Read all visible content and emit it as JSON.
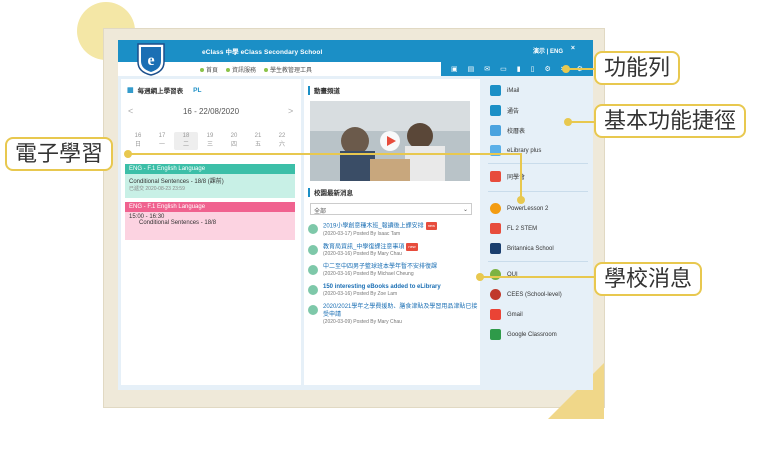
{
  "header": {
    "school": "eClass 中學 eClass Secondary School",
    "lang": "演示 | ENG",
    "close": "×"
  },
  "nav": [
    "首頁",
    "資訊服務",
    "學生教管理工具"
  ],
  "tools": [
    "▣",
    "▤",
    "✉",
    "▭",
    "▮",
    "▯",
    "⚙",
    "✂",
    "⚙"
  ],
  "schedule": {
    "title": "每週網上學習表",
    "tab2": "PL",
    "week": "16 - 22/08/2020",
    "prev": "<",
    "next": ">",
    "days": [
      [
        "16",
        "日"
      ],
      [
        "17",
        "一"
      ],
      [
        "18",
        "二"
      ],
      [
        "19",
        "三"
      ],
      [
        "20",
        "四"
      ],
      [
        "21",
        "五"
      ],
      [
        "22",
        "六"
      ]
    ],
    "events": [
      {
        "head": "ENG - F.1 English Language",
        "title": "Conditional Sentences - 18/8 (課前)",
        "sub": "已遞交  2020-08-23 23:59"
      },
      {
        "head": "ENG - F.1 English Language",
        "title": "15:00 - 16:30",
        "sub": "Conditional Sentences - 18/8"
      }
    ]
  },
  "video": {
    "title": "動畫頻道"
  },
  "news": {
    "title": "校園最新消息",
    "filter": "全部",
    "new": "new",
    "items": [
      {
        "title": "2019小學創意種木班_報讀後上課安排",
        "posted": "(2020-03-17) Posted By Isaac Tam"
      },
      {
        "title": "教育局資訊_中學復課注意事項",
        "posted": "(2020-03-16) Posted By Mary Chau"
      },
      {
        "title": "中二至中四男子籃球班本學年暫不安排復課",
        "posted": "(2020-03-16) Posted By Michael Cheung"
      },
      {
        "title": "150 interesting eBooks added to eLibrary",
        "posted": "(2020-03-16) Posted By Zoe Lam"
      },
      {
        "title": "2020/2021學年之學費援助、膳食津貼及學習用品津貼已接受申請",
        "posted": "(2020-03-09) Posted By Mary Chau"
      }
    ]
  },
  "shortcuts": [
    "iMail",
    "通告",
    "校曆表",
    "eLibrary plus",
    "同學會",
    "PowerLesson 2",
    "FL 2 STEM",
    "Britannica School",
    "OUI",
    "CEES (School-level)",
    "Gmail",
    "Google Classroom"
  ],
  "callouts": {
    "toolbar": "功能列",
    "shortcut": "基本功能捷徑",
    "elearning": "電子學習",
    "news": "學校消息"
  }
}
